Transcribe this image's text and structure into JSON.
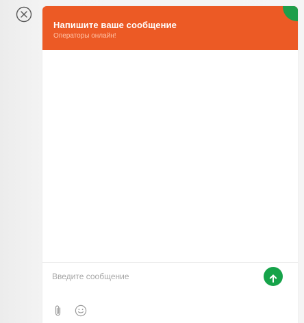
{
  "header": {
    "title": "Напишите ваше сообщение",
    "status": "Операторы онлайн!"
  },
  "composer": {
    "placeholder": "Введите сообщение",
    "value": ""
  },
  "icons": {
    "close": "close-circle-icon",
    "send": "arrow-up-icon",
    "attach": "paperclip-icon",
    "emoji": "smiley-icon",
    "online": "online-status-icon"
  },
  "colors": {
    "header_bg": "#ec5a25",
    "status_text": "#ffc3a8",
    "online_indicator": "#1e9e4a",
    "send_button": "#16a34a"
  }
}
